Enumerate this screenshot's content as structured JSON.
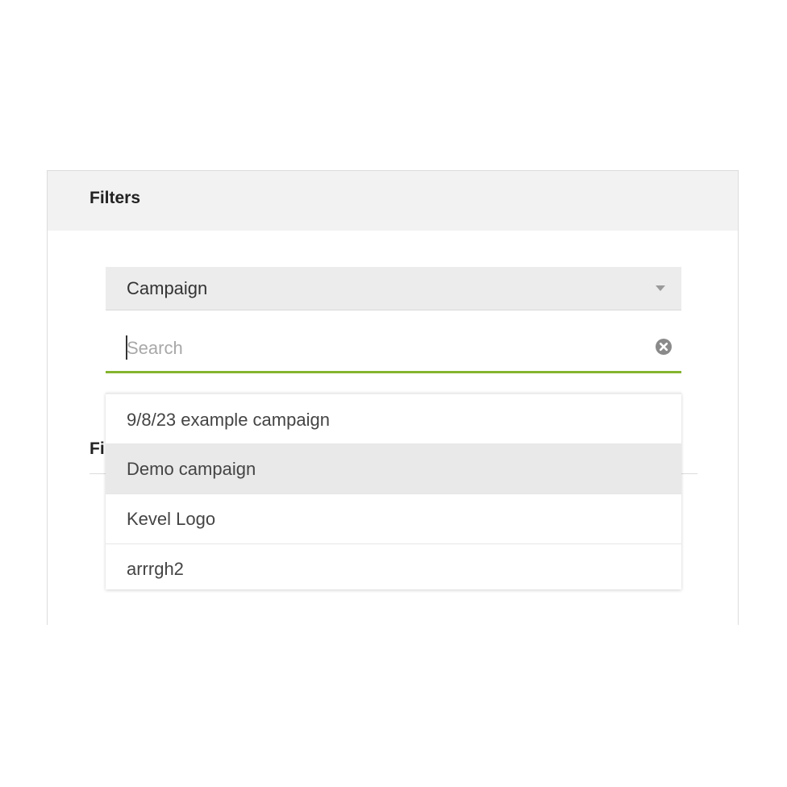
{
  "panel": {
    "title": "Filters"
  },
  "select": {
    "value": "Campaign"
  },
  "search": {
    "placeholder": "Search",
    "value": ""
  },
  "hidden_section": {
    "label_fragment": "Fi"
  },
  "dropdown": {
    "items": [
      {
        "label": "9/8/23 example campaign"
      },
      {
        "label": "Demo campaign"
      },
      {
        "label": "Kevel Logo"
      },
      {
        "label": "arrrgh2"
      }
    ],
    "highlighted_index": 1
  },
  "colors": {
    "accent_underline": "#86b42f",
    "header_bg": "#f2f2f2",
    "select_bg": "#ececec",
    "highlight_bg": "#e9e9e9"
  },
  "icons": {
    "select_caret": "chevron-down-icon",
    "search_clear": "clear-circle-icon"
  }
}
